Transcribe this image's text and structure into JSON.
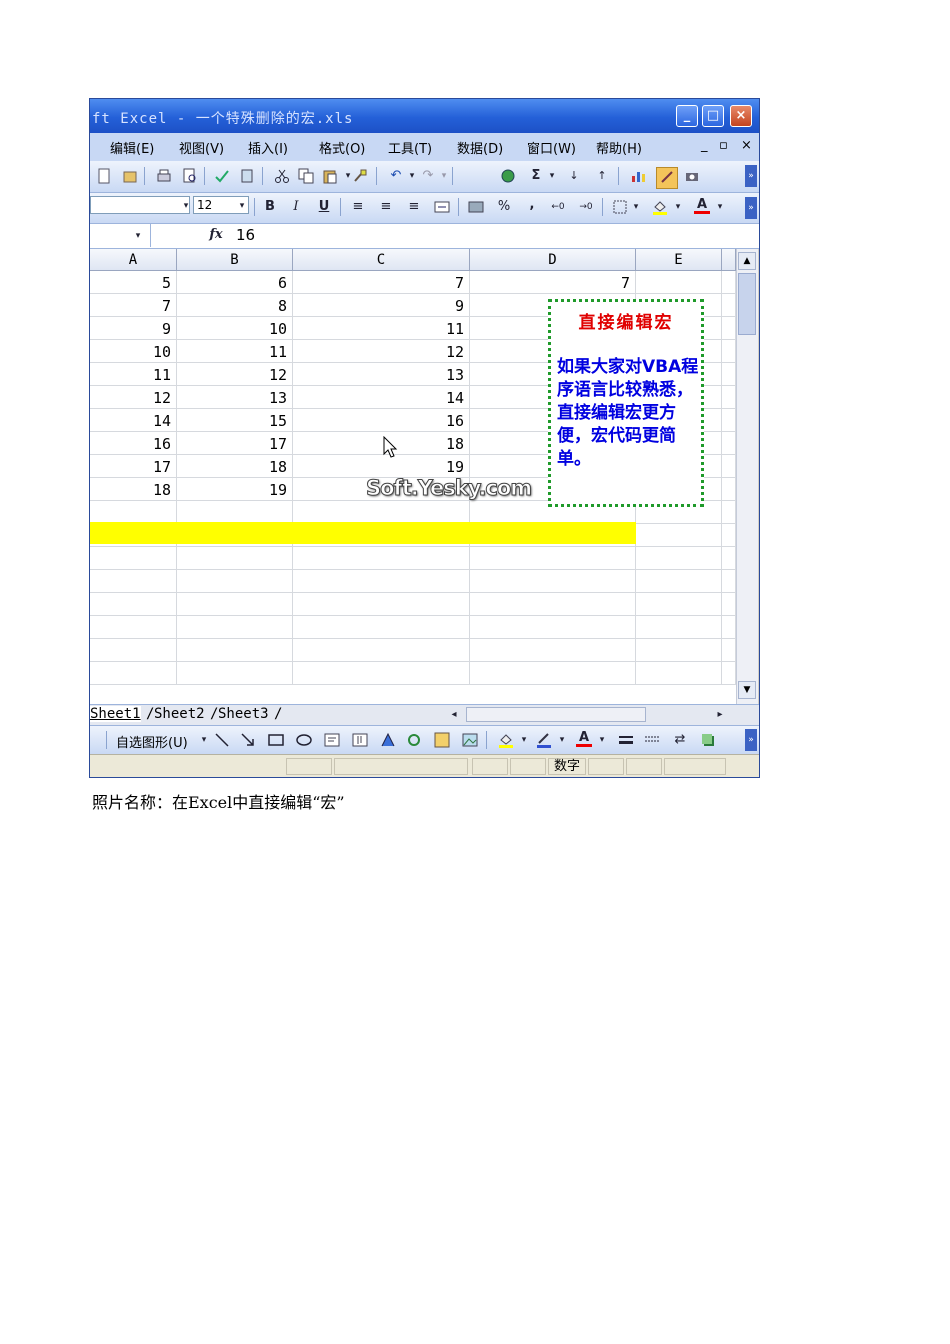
{
  "window": {
    "title": "ft Excel - 一个特殊删除的宏.xls",
    "buttons": {
      "minimize": "_",
      "maximize": "□",
      "close": "×"
    }
  },
  "menubar": {
    "items": [
      "编辑(E)",
      "视图(V)",
      "插入(I)",
      "格式(O)",
      "工具(T)",
      "数据(D)",
      "窗口(W)",
      "帮助(H)"
    ],
    "doc_minimize": "_",
    "doc_restore": "▫",
    "doc_close": "×"
  },
  "format_toolbar": {
    "font_size": "12",
    "bold": "B",
    "italic": "I",
    "underline": "U",
    "percent": "%",
    "comma": ","
  },
  "standard_toolbar": {
    "sigma": "Σ"
  },
  "formula_bar": {
    "fx": "fx",
    "value": "16"
  },
  "sheet": {
    "columns": [
      "A",
      "B",
      "C",
      "D",
      "E"
    ],
    "rows": [
      [
        "5",
        "6",
        "7",
        "7",
        ""
      ],
      [
        "7",
        "8",
        "9",
        "",
        ""
      ],
      [
        "9",
        "10",
        "11",
        "",
        ""
      ],
      [
        "10",
        "11",
        "12",
        "",
        ""
      ],
      [
        "11",
        "12",
        "13",
        "",
        ""
      ],
      [
        "12",
        "13",
        "14",
        "",
        ""
      ],
      [
        "14",
        "15",
        "16",
        "",
        ""
      ],
      [
        "16",
        "17",
        "18",
        "",
        ""
      ],
      [
        "17",
        "18",
        "19",
        "",
        ""
      ],
      [
        "18",
        "19",
        "",
        "",
        ""
      ]
    ],
    "highlight_color": "#ffff00"
  },
  "comment": {
    "title": "直接编辑宏",
    "body": "如果大家对VBA程序语言比较熟悉，直接编辑宏更方便，宏代码更简单。",
    "title_color": "#e00000",
    "body_color": "#0000e0",
    "border_color": "#1f9a2a"
  },
  "watermark": "Soft.Yesky.com",
  "tabs": [
    "Sheet1",
    "Sheet2",
    "Sheet3"
  ],
  "drawing_toolbar": {
    "autoshapes": "自选图形(U)"
  },
  "status_bar": {
    "mode": "数字"
  },
  "caption": "照片名称：在Excel中直接编辑“宏”"
}
